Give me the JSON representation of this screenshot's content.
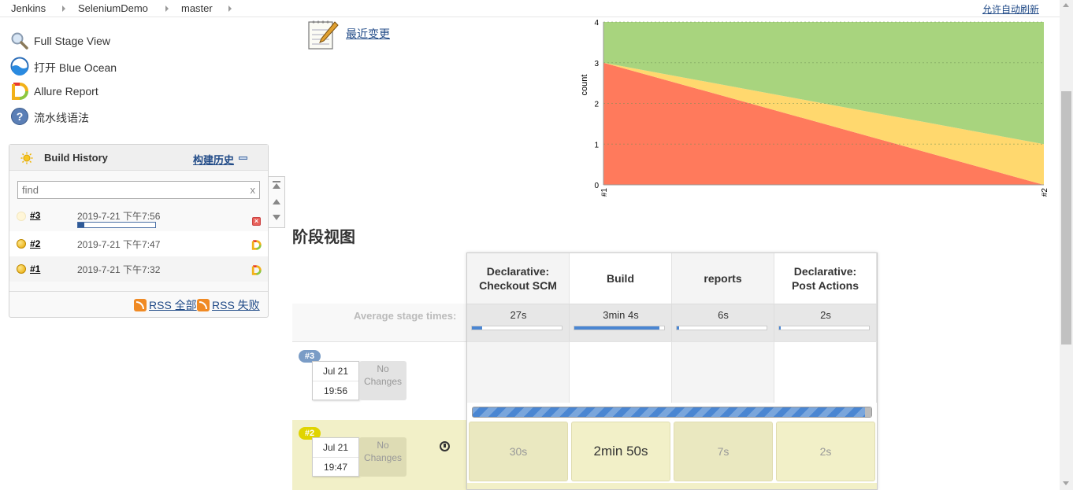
{
  "breadcrumb": [
    "Jenkins",
    "SeleniumDemo",
    "master"
  ],
  "auto_refresh": "允许自动刷新",
  "sidebar": {
    "items": [
      {
        "label": "Full Stage View",
        "icon": "magnifier-icon"
      },
      {
        "label": "打开 Blue Ocean",
        "icon": "blue-ocean-icon"
      },
      {
        "label": "Allure Report",
        "icon": "allure-icon"
      },
      {
        "label": "流水线语法",
        "icon": "help-icon"
      }
    ]
  },
  "build_history": {
    "title": "Build History",
    "trend_link": "构建历史",
    "search_placeholder": "find",
    "search_clear": "x",
    "builds": [
      {
        "number": "#3",
        "date": "2019-7-21 下午7:56",
        "status": "running",
        "progress": 0.08
      },
      {
        "number": "#2",
        "date": "2019-7-21 下午7:47",
        "status": "unstable"
      },
      {
        "number": "#1",
        "date": "2019-7-21 下午7:32",
        "status": "unstable"
      }
    ],
    "rss_all": "RSS 全部",
    "rss_failed": "RSS 失败"
  },
  "recent_changes": "最近变更",
  "chart_data": {
    "type": "area",
    "x": [
      "#1",
      "#2"
    ],
    "ylabel": "count",
    "ylim": [
      0,
      4
    ],
    "yticks": [
      0,
      1,
      2,
      3,
      4
    ],
    "series": [
      {
        "values": [
          3,
          0
        ],
        "color": "#ff7a5c"
      },
      {
        "values": [
          0,
          1
        ],
        "color": "#ffd86e"
      },
      {
        "values": [
          1,
          3
        ],
        "color": "#a8d47e"
      }
    ]
  },
  "stage_view": {
    "title": "阶段视图",
    "avg_label": "Average stage times:",
    "stages": [
      {
        "name_line1": "Declarative:",
        "name_line2": "Checkout SCM",
        "avg": "27s",
        "avg_fill": 0.11
      },
      {
        "name_line1": "Build",
        "name_line2": "",
        "avg": "3min 4s",
        "avg_fill": 0.95
      },
      {
        "name_line1": "reports",
        "name_line2": "",
        "avg": "6s",
        "avg_fill": 0.03
      },
      {
        "name_line1": "Declarative:",
        "name_line2": "Post Actions",
        "avg": "2s",
        "avg_fill": 0.01
      }
    ],
    "runs": [
      {
        "badge": "#3",
        "date": "Jul 21",
        "time": "19:56",
        "changes_line1": "No",
        "changes_line2": "Changes",
        "durations": [
          "",
          "",
          "",
          ""
        ]
      },
      {
        "badge": "#2",
        "date": "Jul 21",
        "time": "19:47",
        "changes_line1": "No",
        "changes_line2": "Changes",
        "durations": [
          "30s",
          "2min 50s",
          "7s",
          "2s"
        ]
      }
    ]
  }
}
